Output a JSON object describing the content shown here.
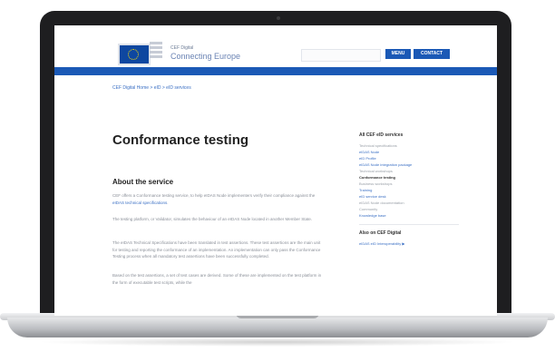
{
  "site": {
    "logo_text": "EU",
    "subtitle": "CEF Digital",
    "title": "Connecting Europe"
  },
  "header": {
    "search_placeholder": "",
    "menu_label": "MENU",
    "contact_label": "CONTACT"
  },
  "breadcrumb": "CEF Digital Home > eID > eID services",
  "page_title": "Conformance testing",
  "about": {
    "heading": "About the service",
    "p1a": "CEF offers a Conformance testing service, to help eIDAS Node implementers verify their compliance against the ",
    "p1_link": "eIDAS technical specifications",
    "p1b": ".",
    "p2": "The testing platform, or Validator, simulates the behaviour of an eIDAS Node located in another Member State.",
    "p3": "The eIDAS Technical Specifications have been translated in test assertions. These test assertions are the main unit for testing and reporting the conformance of an implementation. An implementation can only pass the Conformance Testing process when all mandatory test assertions have been successfully completed.",
    "p4": "Based on the test assertions, a set of test cases are derived. Some of these are implemented on the test platform in the form of executable test scripts, while the"
  },
  "sidebar": {
    "heading": "All CEF eID services",
    "items": [
      {
        "label": "Technical specifications",
        "style": "muted"
      },
      {
        "label": "eIDAS Node",
        "style": "link"
      },
      {
        "label": "eID Profile",
        "style": "link"
      },
      {
        "label": "eIDAS Node integration package",
        "style": "link"
      },
      {
        "label": "Technical workshops",
        "style": "muted"
      },
      {
        "label": "Conformance testing",
        "style": "active"
      },
      {
        "label": "Business workshops",
        "style": "muted"
      },
      {
        "label": "Training",
        "style": "link"
      },
      {
        "label": "eID service desk",
        "style": "link"
      },
      {
        "label": "eIDAS Node documentation",
        "style": "muted"
      },
      {
        "label": "Community",
        "style": "muted"
      },
      {
        "label": "Knowledge base",
        "style": "link"
      }
    ],
    "also_heading": "Also on CEF Digital",
    "also_link": "eIDAS eID Interoperability ▶"
  },
  "colors": {
    "brand_blue": "#1b59b6",
    "link": "#3a6fc4"
  }
}
